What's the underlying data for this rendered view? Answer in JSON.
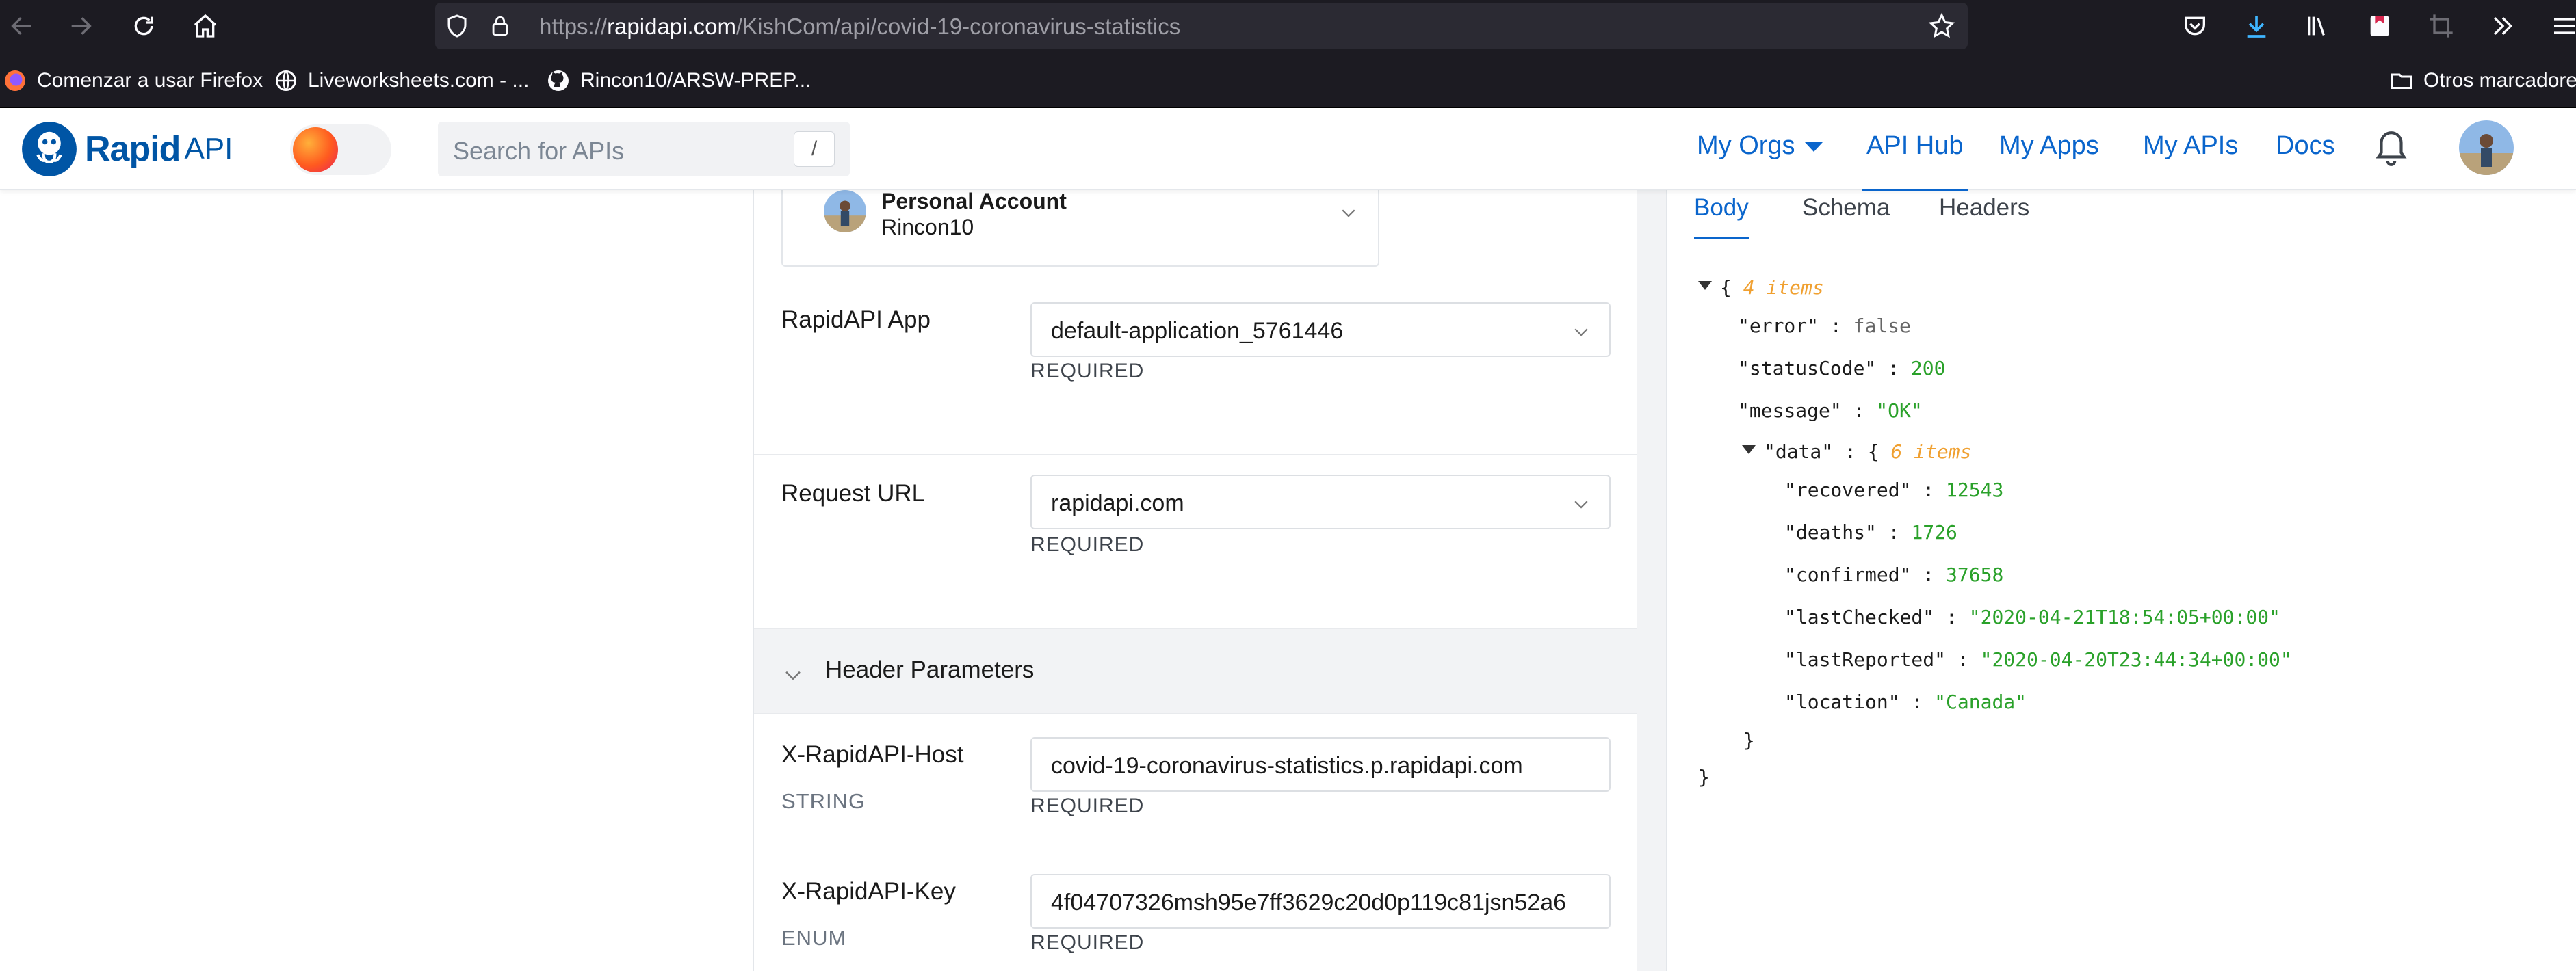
{
  "browser": {
    "url_prefix": "https://",
    "url_domain": "rapidapi.com",
    "url_path": "/KishCom/api/covid-19-coronavirus-statistics",
    "bookmarks": [
      "Comenzar a usar Firefox",
      "Liveworksheets.com - ...",
      "Rincon10/ARSW-PREP..."
    ],
    "other_bookmarks": "Otros marcadores"
  },
  "header": {
    "logo_rapid": "Rapid",
    "logo_api": "API",
    "search_placeholder": "Search for APIs",
    "search_shortcut": "/",
    "nav": {
      "my_orgs": "My Orgs",
      "api_hub": "API Hub",
      "my_apps": "My Apps",
      "my_apis": "My APIs",
      "docs": "Docs"
    }
  },
  "request": {
    "account_type": "Personal Account",
    "account_name": "Rincon10",
    "app_label": "RapidAPI App",
    "app_value": "default-application_5761446",
    "app_required": "REQUIRED",
    "url_label": "Request URL",
    "url_value": "rapidapi.com",
    "url_required": "REQUIRED",
    "section_title": "Header Parameters",
    "host_label": "X-RapidAPI-Host",
    "host_type": "STRING",
    "host_value": "covid-19-coronavirus-statistics.p.rapidapi.com",
    "host_required": "REQUIRED",
    "key_label": "X-RapidAPI-Key",
    "key_type": "ENUM",
    "key_value": "4f04707326msh95e7ff3629c20d0p119c81jsn52a6",
    "key_required": "REQUIRED"
  },
  "response": {
    "tabs": [
      "Body",
      "Schema",
      "Headers"
    ],
    "root_count": "4 items",
    "error_key": "\"error\"",
    "error_val": "false",
    "status_key": "\"statusCode\"",
    "status_val": "200",
    "message_key": "\"message\"",
    "message_val": "\"OK\"",
    "data_key": "\"data\"",
    "data_count": "6 items",
    "recovered_key": "\"recovered\"",
    "recovered_val": "12543",
    "deaths_key": "\"deaths\"",
    "deaths_val": "1726",
    "confirmed_key": "\"confirmed\"",
    "confirmed_val": "37658",
    "lastchecked_key": "\"lastChecked\"",
    "lastchecked_val": "\"2020-04-21T18:54:05+00:00\"",
    "lastreported_key": "\"lastReported\"",
    "lastreported_val": "\"2020-04-20T23:44:34+00:00\"",
    "location_key": "\"location\"",
    "location_val": "\"Canada\""
  }
}
